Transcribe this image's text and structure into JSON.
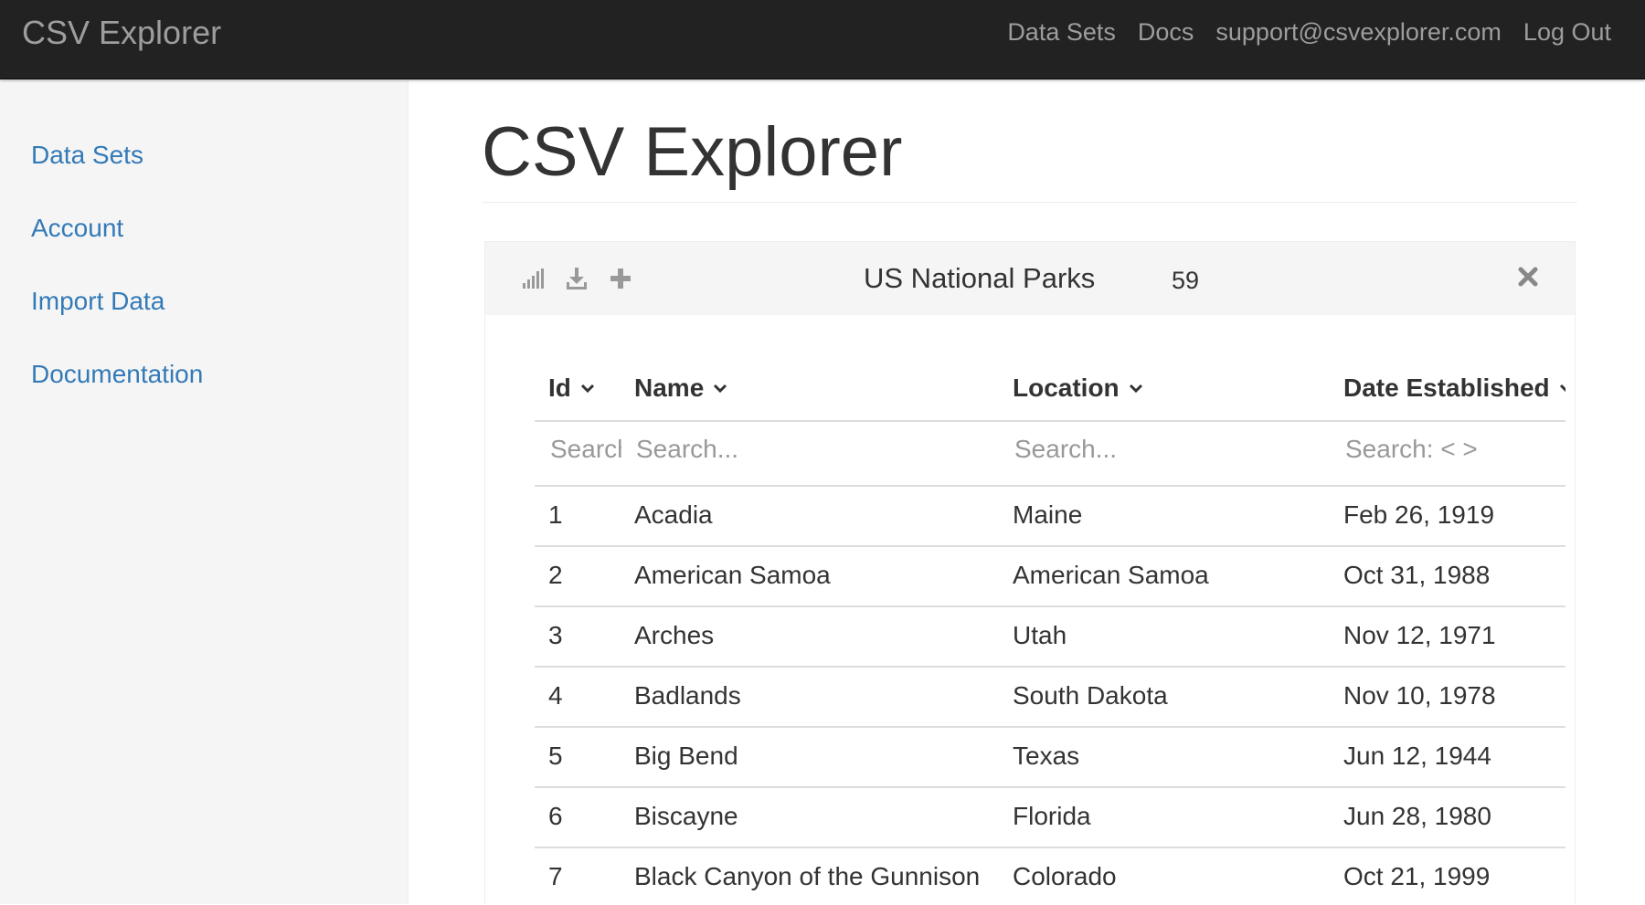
{
  "navbar": {
    "brand": "CSV Explorer",
    "links": [
      "Data Sets",
      "Docs",
      "support@csvexplorer.com",
      "Log Out"
    ]
  },
  "sidebar": {
    "items": [
      "Data Sets",
      "Account",
      "Import Data",
      "Documentation"
    ]
  },
  "main": {
    "title": "CSV Explorer"
  },
  "panel": {
    "tools": [
      "bar-chart-icon",
      "download-icon",
      "plus-icon"
    ],
    "title": "US National Parks",
    "count": "59",
    "close_icon": "close-icon"
  },
  "table": {
    "columns": [
      {
        "label": "Id",
        "placeholder": "Search..."
      },
      {
        "label": "Name",
        "placeholder": "Search..."
      },
      {
        "label": "Location",
        "placeholder": "Search..."
      },
      {
        "label": "Date Established",
        "placeholder": "Search: < >"
      }
    ],
    "rows": [
      [
        "1",
        "Acadia",
        "Maine",
        "Feb 26, 1919"
      ],
      [
        "2",
        "American Samoa",
        "American Samoa",
        "Oct 31, 1988"
      ],
      [
        "3",
        "Arches",
        "Utah",
        "Nov 12, 1971"
      ],
      [
        "4",
        "Badlands",
        "South Dakota",
        "Nov 10, 1978"
      ],
      [
        "5",
        "Big Bend",
        "Texas",
        "Jun 12, 1944"
      ],
      [
        "6",
        "Biscayne",
        "Florida",
        "Jun 28, 1980"
      ],
      [
        "7",
        "Black Canyon of the Gunnison",
        "Colorado",
        "Oct 21, 1999"
      ]
    ]
  },
  "colors": {
    "navbar_bg": "#222222",
    "nav_text": "#9d9d9d",
    "link": "#337ab7",
    "sidebar_bg": "#f5f5f5",
    "text": "#333333"
  }
}
